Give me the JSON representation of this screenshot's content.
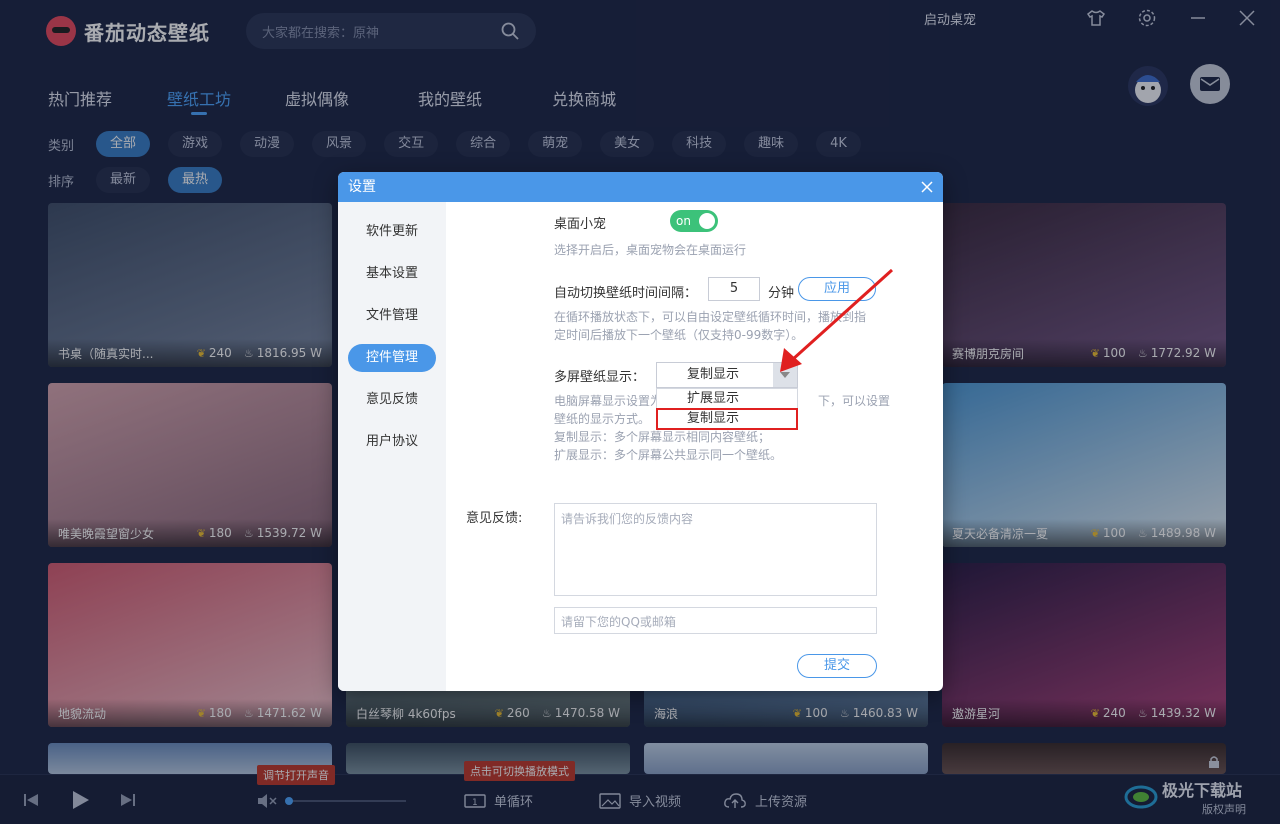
{
  "app": {
    "name": "番茄动态壁纸",
    "search_placeholder": "大家都在搜索：原神",
    "start_desk_pet": "启动桌宠"
  },
  "nav": {
    "tabs": [
      {
        "label": "热门推荐"
      },
      {
        "label": "壁纸工坊"
      },
      {
        "label": "虚拟偶像"
      },
      {
        "label": "我的壁纸"
      },
      {
        "label": "兑换商城"
      }
    ]
  },
  "filters": {
    "category_label": "类别",
    "categories": [
      "全部",
      "游戏",
      "动漫",
      "风景",
      "交互",
      "综合",
      "萌宠",
      "美女",
      "科技",
      "趣味",
      "4K"
    ],
    "sort_label": "排序",
    "sorts": [
      "最新",
      "最热"
    ]
  },
  "wallpapers": [
    {
      "title": "书桌（随真实时...",
      "likes": "240",
      "heat": "1816.95 W",
      "colors": [
        "#41506a",
        "#7c8aa3"
      ]
    },
    {
      "title": "赛博朋克房间",
      "likes": "100",
      "heat": "1772.92 W",
      "colors": [
        "#3b2a3e",
        "#7a5b8a"
      ]
    },
    {
      "title": "唯美晚霞望窗少女",
      "likes": "180",
      "heat": "1539.72 W",
      "colors": [
        "#d9a7b0",
        "#8d6a7c"
      ]
    },
    {
      "title": "夏天必备清凉一夏",
      "likes": "100",
      "heat": "1489.98 W",
      "colors": [
        "#4f9ad6",
        "#e6f0f7"
      ]
    },
    {
      "title": "地貌流动",
      "likes": "180",
      "heat": "1471.62 W",
      "colors": [
        "#d75d72",
        "#f3c7cf"
      ]
    },
    {
      "title": "白丝琴柳 4k60fps",
      "likes": "260",
      "heat": "1470.58 W",
      "colors": [
        "#3a4b55",
        "#788a8e"
      ]
    },
    {
      "title": "海浪",
      "likes": "100",
      "heat": "1460.83 W",
      "colors": [
        "#2d4a6e",
        "#6e8fb6"
      ]
    },
    {
      "title": "遨游星河",
      "likes": "240",
      "heat": "1439.32 W",
      "colors": [
        "#2c1d45",
        "#b4447d"
      ]
    }
  ],
  "bottombar": {
    "tooltip_sound": "调节打开声音",
    "tooltip_mode": "点击可切换播放模式",
    "loop_mode": "单循环",
    "import_video": "导入视频",
    "upload": "上传资源",
    "watermark": "极光下载站",
    "copyright": "版权声明"
  },
  "dialog": {
    "title": "设置",
    "menu": [
      "软件更新",
      "基本设置",
      "文件管理",
      "控件管理",
      "意见反馈",
      "用户协议"
    ],
    "active_menu": "控件管理",
    "desk_pet_label": "桌面小宠",
    "toggle_text": "on",
    "desk_pet_hint": "选择开启后，桌面宠物会在桌面运行",
    "interval_label": "自动切换壁纸时间间隔：",
    "interval_value": "5",
    "interval_unit": "分钟",
    "apply": "应用",
    "interval_hint_1": "在循环播放状态下，可以自由设定壁纸循环时间，播放到指",
    "interval_hint_2": "定时间后播放下一个壁纸（仅支持0-99数字）。",
    "multiscreen_label": "多屏壁纸显示：",
    "multiscreen_value": "复制显示",
    "multiscreen_options": [
      "扩展显示",
      "复制显示"
    ],
    "ms_hint_1": "电脑屏幕显示设置为",
    "ms_hint_1b": "下，可以设置",
    "ms_hint_2": "壁纸的显示方式。",
    "ms_hint_3": "复制显示：多个屏幕显示相同内容壁纸；",
    "ms_hint_4": "扩展显示：多个屏幕公共显示同一个壁纸。",
    "feedback_label": "意见反馈:",
    "feedback_placeholder": "请告诉我们您的反馈内容",
    "contact_placeholder": "请留下您的QQ或邮箱",
    "submit": "提交"
  }
}
